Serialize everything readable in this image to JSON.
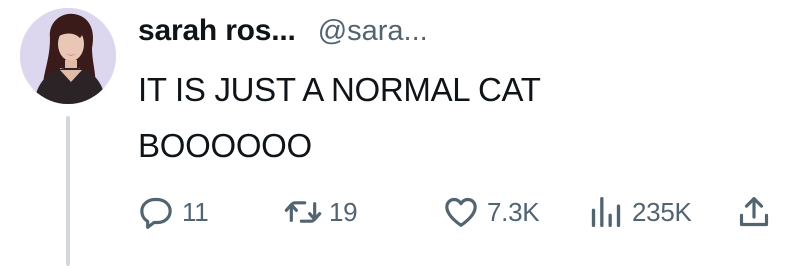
{
  "author": {
    "display_name": "sarah ros...",
    "handle": "@sara..."
  },
  "tweet": {
    "lines": [
      "IT IS JUST A NORMAL CAT",
      "BOOOOOO"
    ]
  },
  "actions": {
    "replies": "11",
    "retweets": "19",
    "likes": "7.3K",
    "views": "235K"
  },
  "colors": {
    "text": "#0f1419",
    "secondary": "#536471",
    "thread_line": "#cfd9de"
  },
  "icons": [
    "reply-icon",
    "retweet-icon",
    "like-icon",
    "views-icon",
    "share-icon"
  ]
}
